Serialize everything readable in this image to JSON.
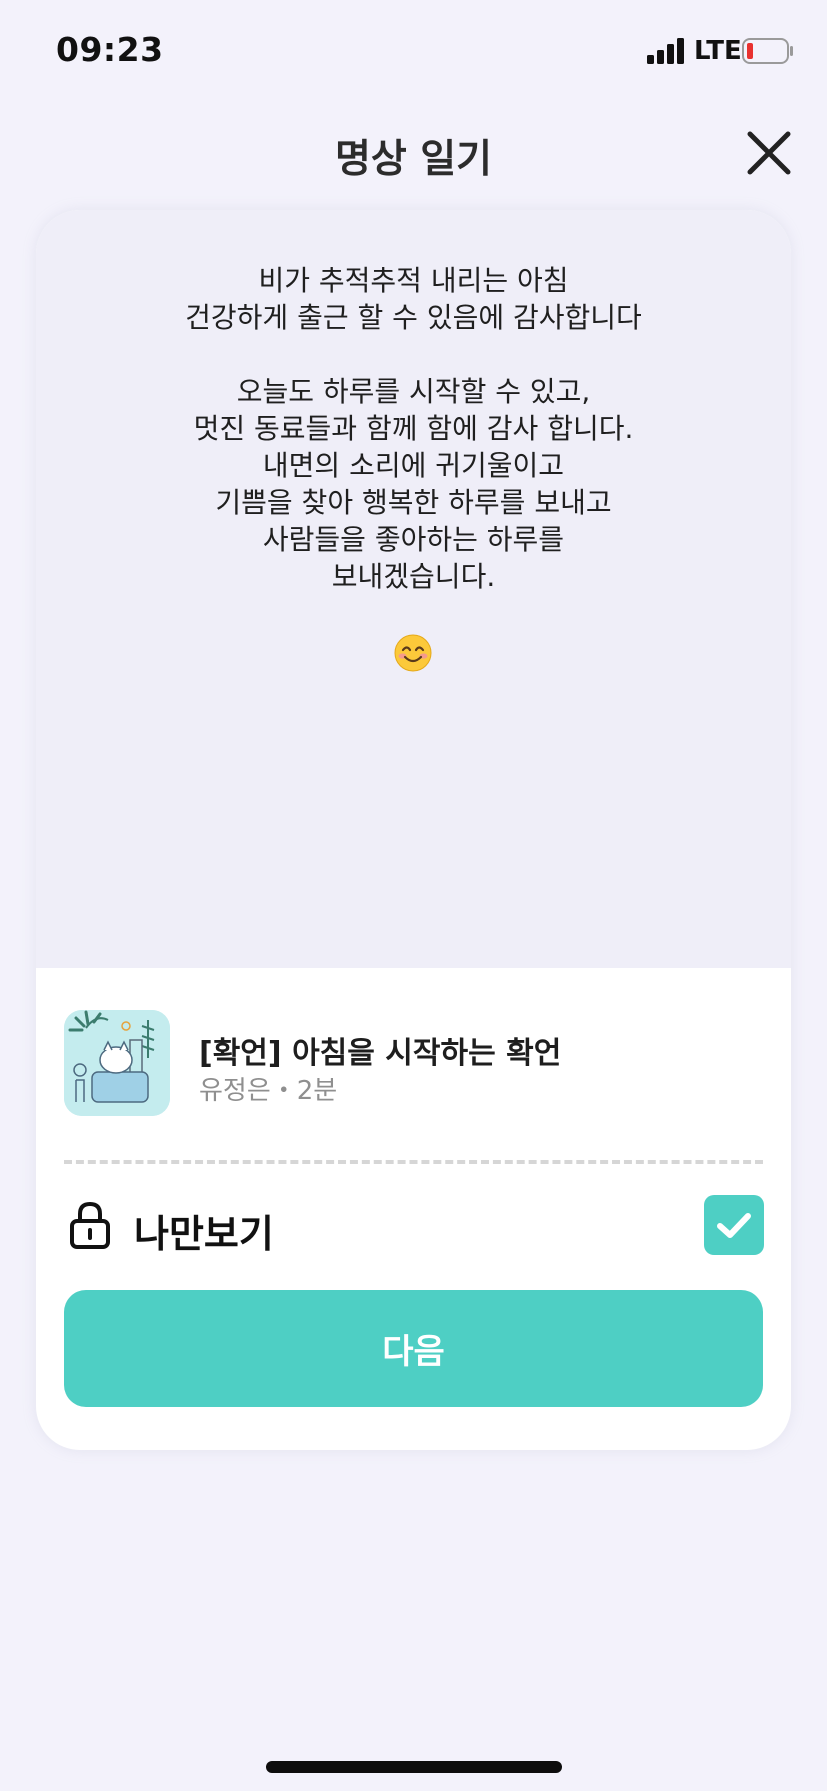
{
  "status_bar": {
    "time": "09:23",
    "network": "LTE"
  },
  "header": {
    "title": "명상 일기"
  },
  "diary": {
    "lines": [
      "비가 추적추적 내리는 아침",
      "건강하게 출근 할 수 있음에 감사합니다",
      "",
      "오늘도 하루를 시작할 수 있고,",
      "멋진 동료들과 함께 함에 감사 합니다.",
      "내면의 소리에 귀기울이고",
      "기쁨을 찾아 행복한 하루를 보내고",
      "사람들을 좋아하는 하루를",
      "보내겠습니다."
    ],
    "emoji": "smiling-face-icon"
  },
  "program": {
    "title": "[확언] 아침을 시작하는 확언",
    "meta": "유정은・2분"
  },
  "privacy": {
    "label": "나만보기",
    "checked": true
  },
  "next_button": {
    "label": "다음"
  },
  "colors": {
    "accent": "#4ecfc4",
    "background": "#f3f2fb",
    "diary_background": "#efeef8"
  }
}
